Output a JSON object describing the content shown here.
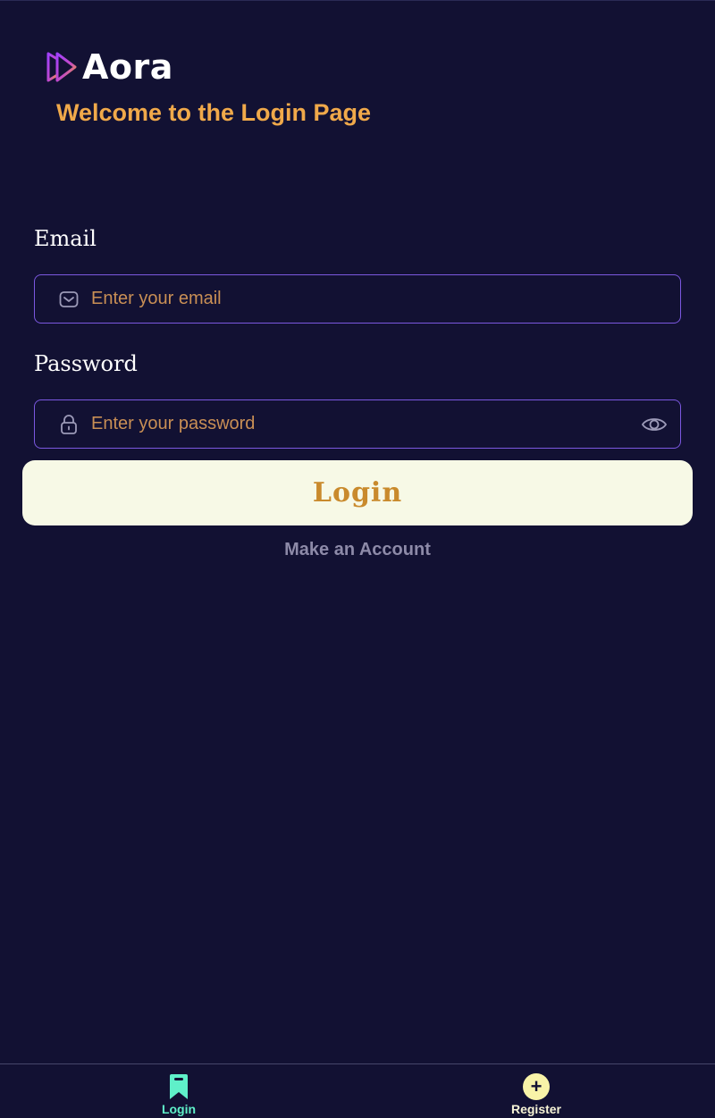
{
  "app": {
    "name": "Aora",
    "welcome": "Welcome to the Login Page"
  },
  "form": {
    "email_label": "Email",
    "email_placeholder": "Enter your email",
    "email_value": "",
    "password_label": "Password",
    "password_placeholder": "Enter your password",
    "password_value": "",
    "login_button": "Login",
    "make_account_link": "Make an Account"
  },
  "icons": {
    "email": "mail-icon",
    "password": "lock-icon",
    "toggle_visibility": "eye-icon",
    "nav_login": "bookmark-icon",
    "nav_register": "plus-circle-icon"
  },
  "bottom_nav": {
    "items": [
      {
        "label": "Login",
        "active": true
      },
      {
        "label": "Register",
        "active": false
      }
    ]
  },
  "colors": {
    "background": "#121133",
    "accent": "#f0a94a",
    "input_border": "#7b58e0",
    "active_tab": "#5ff0c9",
    "button_bg": "#f7f9e6"
  }
}
